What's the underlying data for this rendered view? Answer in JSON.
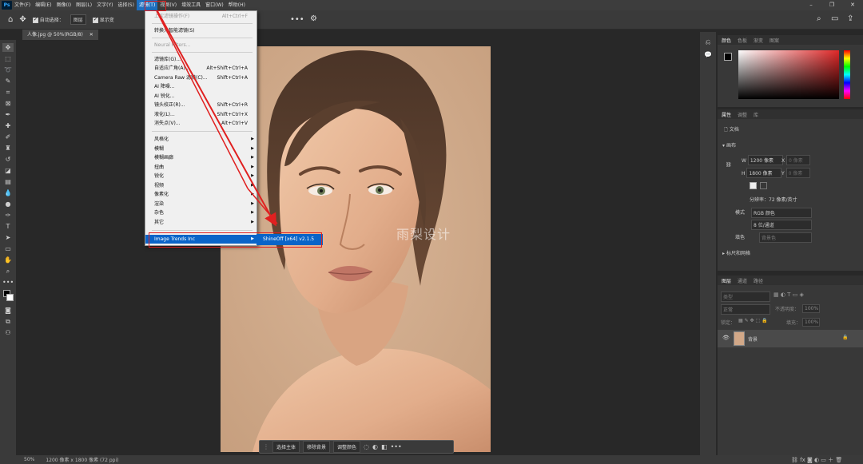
{
  "menubar": {
    "logo": "Ps",
    "items": [
      "文件(F)",
      "编辑(E)",
      "图像(I)",
      "图层(L)",
      "文字(Y)",
      "选择(S)",
      "滤镜(T)",
      "视图(V)",
      "增效工具",
      "窗口(W)",
      "帮助(H)"
    ],
    "active_index": 6
  },
  "optionsbar": {
    "auto_select_label": "自动选择：",
    "auto_select_value": "图层",
    "show_transform_label": "显示变"
  },
  "document": {
    "tab_title": "人像.jpg @ 50%(RGB/8)",
    "watermark": "雨梨设计"
  },
  "filter_menu": {
    "last_filter": {
      "label": "上次滤镜操作(F)",
      "shortcut": "Alt+Ctrl+F"
    },
    "convert_smart": "转换为智能滤镜(S)",
    "neural": "Neural Filters...",
    "group1": [
      {
        "label": "滤镜库(G)...",
        "shortcut": ""
      },
      {
        "label": "自适应广角(A)...",
        "shortcut": "Alt+Shift+Ctrl+A"
      },
      {
        "label": "Camera Raw 滤镜(C)...",
        "shortcut": "Shift+Ctrl+A"
      },
      {
        "label": "AI 降噪...",
        "shortcut": ""
      },
      {
        "label": "AI 锐化...",
        "shortcut": ""
      },
      {
        "label": "镜头校正(R)...",
        "shortcut": "Shift+Ctrl+R"
      },
      {
        "label": "液化(L)...",
        "shortcut": "Shift+Ctrl+X"
      },
      {
        "label": "消失点(V)...",
        "shortcut": "Alt+Ctrl+V"
      }
    ],
    "group2": [
      "风格化",
      "模糊",
      "模糊画廊",
      "扭曲",
      "锐化",
      "视频",
      "像素化",
      "渲染",
      "杂色",
      "其它"
    ],
    "plugin": "Image Trends Inc",
    "submenu_item": "ShineOff [x64] v2.1.5"
  },
  "context_bar": {
    "select_subject": "选择主体",
    "remove_bg": "移除背景",
    "adjust_color": "调整颜色"
  },
  "statusbar": {
    "zoom": "50%",
    "doc_info": "1200 像素 x 1800 像素 (72 ppi)"
  },
  "color_panel": {
    "tabs": [
      "颜色",
      "色板",
      "渐变",
      "图案"
    ],
    "fg": "#000000",
    "bg": "#ffffff"
  },
  "properties_panel": {
    "tabs": [
      "属性",
      "调整",
      "库"
    ],
    "doc_label": "文档",
    "canvas_header": "画布",
    "w_label": "W",
    "w_value": "1200 像素",
    "h_label": "H",
    "h_value": "1800 像素",
    "x_label": "X",
    "x_value": "0 像素",
    "y_label": "Y",
    "y_value": "0 像素",
    "resolution": "分辨率：72 像素/英寸",
    "mode_label": "模式",
    "mode_value": "RGB 颜色",
    "depth_value": "8 位/通道",
    "fill_label": "填色",
    "fill_value": "背景色",
    "rulers_header": "标尺和网格"
  },
  "layers_panel": {
    "tabs": [
      "图层",
      "通道",
      "路径"
    ],
    "search_placeholder": "类型",
    "blend_mode": "正常",
    "opacity_label": "不透明度：",
    "opacity_value": "100%",
    "lock_label": "锁定：",
    "fill_label": "填充：",
    "fill_value": "100%",
    "layer_name": "背景"
  },
  "colors": {
    "menu_highlight": "#0a64c8",
    "annotation": "#e02020"
  }
}
